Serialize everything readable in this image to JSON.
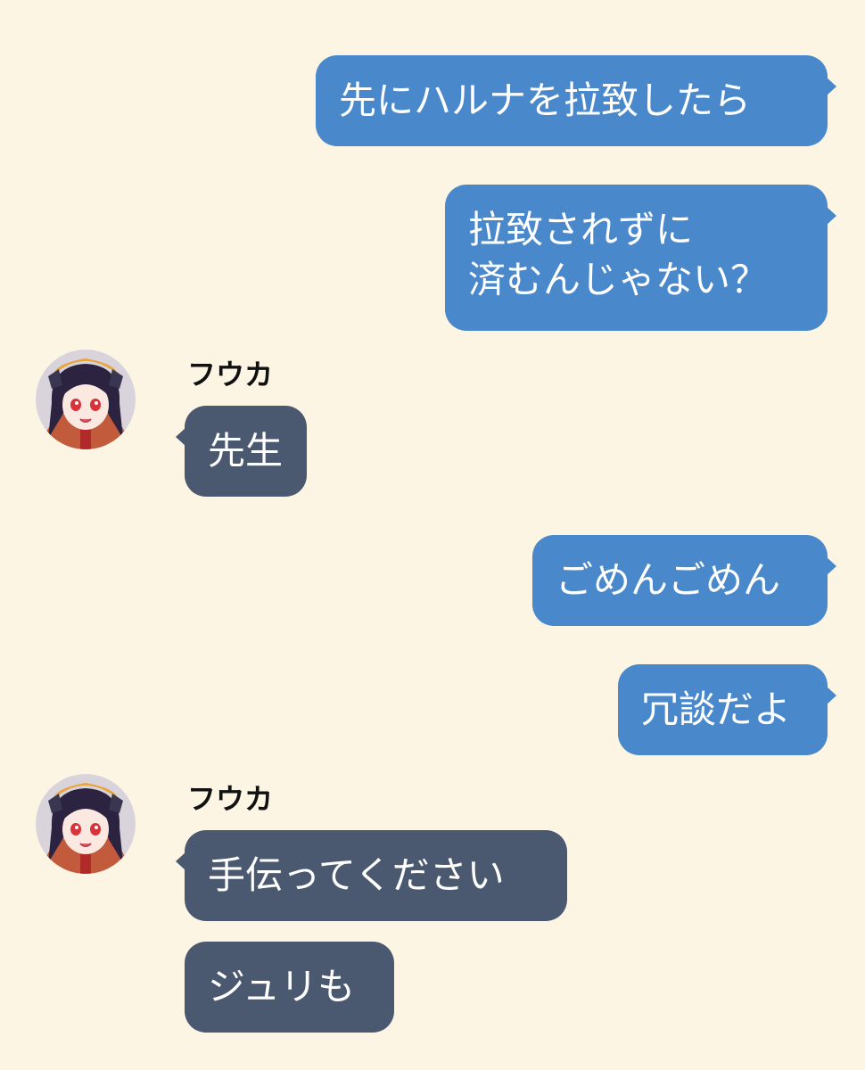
{
  "chat": {
    "messages": [
      {
        "side": "out",
        "lines": [
          "先にハルナを拉致したら"
        ]
      },
      {
        "side": "out",
        "lines": [
          "拉致されずに",
          "済むんじゃない？"
        ]
      },
      {
        "side": "in",
        "sender": "フウカ",
        "avatar": "character-avatar-icon",
        "lines": [
          "先生"
        ]
      },
      {
        "side": "out",
        "lines": [
          "ごめんごめん"
        ]
      },
      {
        "side": "out",
        "lines": [
          "冗談だよ"
        ]
      },
      {
        "side": "in",
        "sender": "フウカ",
        "avatar": "character-avatar-icon",
        "lines": [
          "手伝ってください"
        ]
      },
      {
        "side": "in",
        "lines": [
          "ジュリも"
        ]
      }
    ]
  },
  "colors": {
    "background": "#fdf5e3",
    "outgoing_bubble": "#4a88cc",
    "incoming_bubble": "#4b5970",
    "bubble_text": "#ffffff",
    "sender_name": "#111111"
  }
}
